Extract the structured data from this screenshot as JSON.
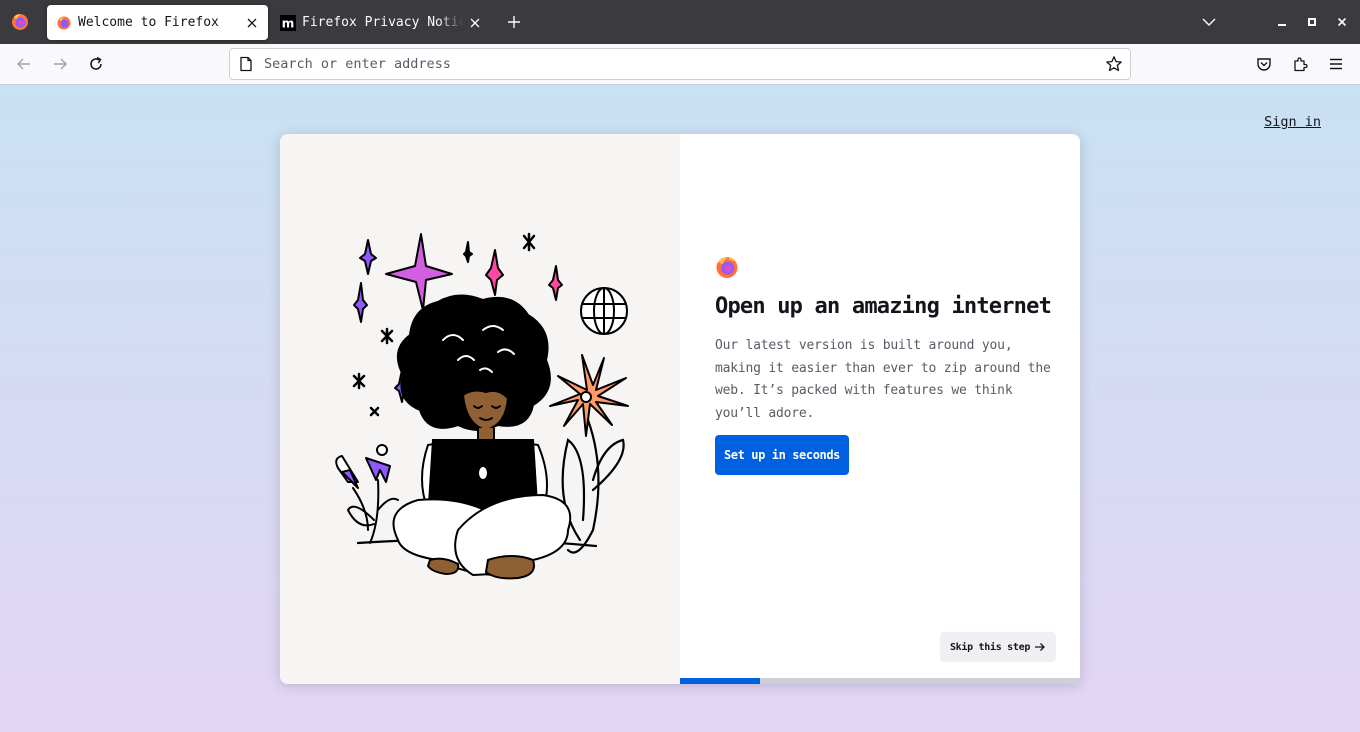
{
  "tabs": [
    {
      "title": "Welcome to Firefox",
      "active": true,
      "favicon": "firefox-icon"
    },
    {
      "title": "Firefox Privacy Notice — Mozilla",
      "active": false,
      "favicon": "mozilla-m-icon"
    }
  ],
  "toolbar": {
    "url_placeholder": "Search or enter address",
    "url_value": ""
  },
  "page": {
    "sign_in": "Sign in",
    "headline": "Open up an amazing internet",
    "subtext": "Our latest version is built around you, making it easier than ever to zip around the web. It’s packed with features we think you’ll adore.",
    "primary_button": "Set up in seconds",
    "skip_button": "Skip this step",
    "progress": 0.2
  },
  "colors": {
    "accent": "#0061e0",
    "tabstrip": "#3b3b3f",
    "toolbar": "#f9f9fb",
    "card_left": "#f6f5f4",
    "bg_top": "#c8e1f3",
    "bg_bottom": "#e2d5f4"
  }
}
